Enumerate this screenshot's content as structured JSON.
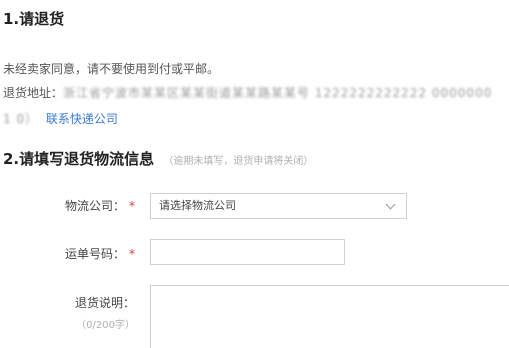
{
  "section1": {
    "title": "1.请退货",
    "notice": "未经卖家同意，请不要使用到付或平邮。",
    "address_label": "退货地址：",
    "address_value_line1": "浙江省宁波市某某区某某街道某某路某某号 1222222222222  0000000",
    "address_value_line2": "1            0）",
    "contact_link": "联系快递公司"
  },
  "section2": {
    "title": "2.请填写退货物流信息",
    "hint": "（逾期未填写，退货申请将关闭）",
    "company_label": "物流公司：",
    "company_select_value": "请选择物流公司",
    "tracking_label": "运单号码：",
    "tracking_value": "",
    "note_label": "退货说明：",
    "note_counter": "（0/200字）",
    "note_value": "",
    "required_mark": "*"
  }
}
